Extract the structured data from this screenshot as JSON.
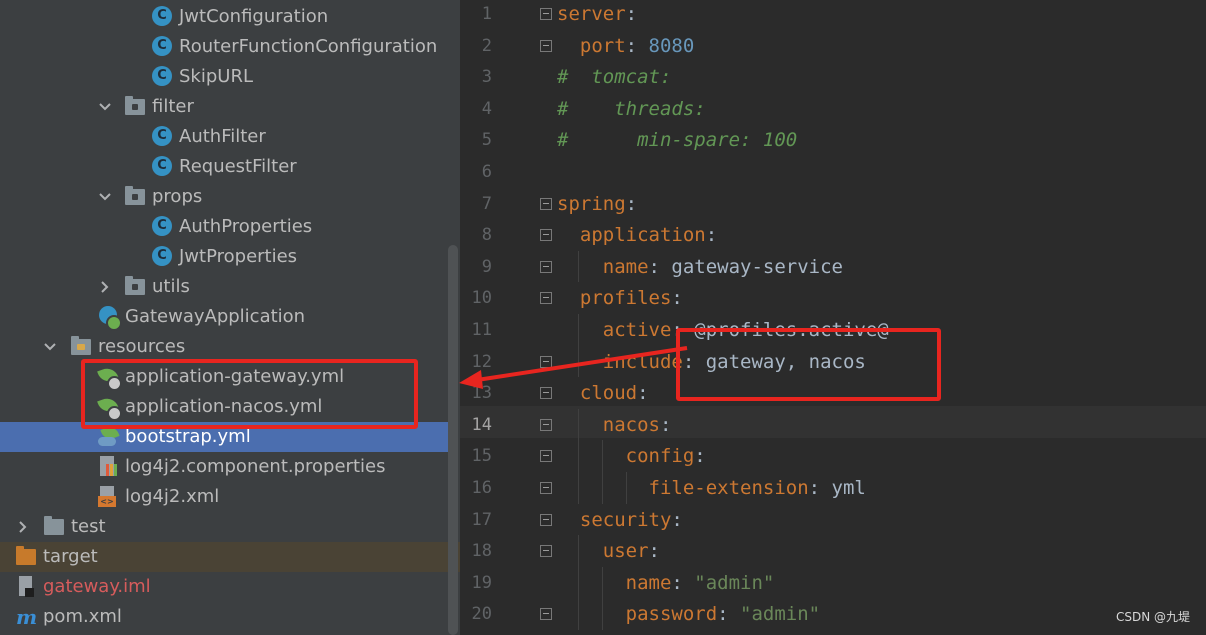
{
  "tree": {
    "items": [
      {
        "label": "JwtConfiguration",
        "icon": "class-icon"
      },
      {
        "label": "RouterFunctionConfiguration",
        "icon": "class-icon"
      },
      {
        "label": "SkipURL",
        "icon": "class-icon"
      },
      {
        "label": "filter",
        "icon": "package-folder-icon",
        "expanded": true
      },
      {
        "label": "AuthFilter",
        "icon": "class-icon"
      },
      {
        "label": "RequestFilter",
        "icon": "class-icon"
      },
      {
        "label": "props",
        "icon": "package-folder-icon",
        "expanded": true
      },
      {
        "label": "AuthProperties",
        "icon": "class-icon"
      },
      {
        "label": "JwtProperties",
        "icon": "class-icon"
      },
      {
        "label": "utils",
        "icon": "package-folder-icon",
        "expanded": false
      },
      {
        "label": "GatewayApplication",
        "icon": "spring-boot-app-icon"
      },
      {
        "label": "resources",
        "icon": "resources-folder-icon",
        "expanded": true
      },
      {
        "label": "application-gateway.yml",
        "icon": "spring-config-icon"
      },
      {
        "label": "application-nacos.yml",
        "icon": "spring-config-icon"
      },
      {
        "label": "bootstrap.yml",
        "icon": "spring-cloud-config-icon",
        "selected": true
      },
      {
        "label": "log4j2.component.properties",
        "icon": "properties-file-icon"
      },
      {
        "label": "log4j2.xml",
        "icon": "xml-file-icon"
      },
      {
        "label": "test",
        "icon": "folder-icon",
        "expanded": false
      },
      {
        "label": "target",
        "icon": "excluded-folder-icon"
      },
      {
        "label": "gateway.iml",
        "icon": "iml-file-icon"
      },
      {
        "label": "pom.xml",
        "icon": "maven-icon"
      }
    ]
  },
  "editor": {
    "current_line": 14,
    "lines": [
      {
        "num": "1",
        "parts": [
          [
            "k",
            "server"
          ],
          [
            "p",
            ":"
          ]
        ]
      },
      {
        "num": "2",
        "parts": [
          [
            "p",
            "  "
          ],
          [
            "k",
            "port"
          ],
          [
            "p",
            ": "
          ],
          [
            "n",
            "8080"
          ]
        ]
      },
      {
        "num": "3",
        "parts": [
          [
            "c",
            "#  tomcat:"
          ]
        ]
      },
      {
        "num": "4",
        "parts": [
          [
            "c",
            "#    threads:"
          ]
        ]
      },
      {
        "num": "5",
        "parts": [
          [
            "c",
            "#      min-spare: 100"
          ]
        ]
      },
      {
        "num": "6",
        "parts": []
      },
      {
        "num": "7",
        "parts": [
          [
            "k",
            "spring"
          ],
          [
            "p",
            ":"
          ]
        ]
      },
      {
        "num": "8",
        "parts": [
          [
            "p",
            "  "
          ],
          [
            "k",
            "application"
          ],
          [
            "p",
            ":"
          ]
        ]
      },
      {
        "num": "9",
        "parts": [
          [
            "p",
            "    "
          ],
          [
            "k",
            "name"
          ],
          [
            "p",
            ": gateway-service"
          ]
        ]
      },
      {
        "num": "10",
        "parts": [
          [
            "p",
            "  "
          ],
          [
            "k",
            "profiles"
          ],
          [
            "p",
            ":"
          ]
        ]
      },
      {
        "num": "11",
        "parts": [
          [
            "p",
            "    "
          ],
          [
            "k",
            "active"
          ],
          [
            "p",
            ": @profiles.active@"
          ]
        ]
      },
      {
        "num": "12",
        "parts": [
          [
            "p",
            "    "
          ],
          [
            "k",
            "include"
          ],
          [
            "p",
            ": gateway, nacos"
          ]
        ]
      },
      {
        "num": "13",
        "parts": [
          [
            "p",
            "  "
          ],
          [
            "k",
            "cloud"
          ],
          [
            "p",
            ":"
          ]
        ]
      },
      {
        "num": "14",
        "parts": [
          [
            "p",
            "    "
          ],
          [
            "k",
            "nacos"
          ],
          [
            "p",
            ":"
          ]
        ]
      },
      {
        "num": "15",
        "parts": [
          [
            "p",
            "      "
          ],
          [
            "k",
            "config"
          ],
          [
            "p",
            ":"
          ]
        ]
      },
      {
        "num": "16",
        "parts": [
          [
            "p",
            "        "
          ],
          [
            "k",
            "file-extension"
          ],
          [
            "p",
            ": yml"
          ]
        ]
      },
      {
        "num": "17",
        "parts": [
          [
            "p",
            "  "
          ],
          [
            "k",
            "security"
          ],
          [
            "p",
            ":"
          ]
        ]
      },
      {
        "num": "18",
        "parts": [
          [
            "p",
            "    "
          ],
          [
            "k",
            "user"
          ],
          [
            "p",
            ":"
          ]
        ]
      },
      {
        "num": "19",
        "parts": [
          [
            "p",
            "      "
          ],
          [
            "k",
            "name"
          ],
          [
            "p",
            ": "
          ],
          [
            "s",
            "\"admin\""
          ]
        ]
      },
      {
        "num": "20",
        "parts": [
          [
            "p",
            "      "
          ],
          [
            "k",
            "password"
          ],
          [
            "p",
            ": "
          ],
          [
            "s",
            "\"admin\""
          ]
        ]
      }
    ]
  },
  "watermark": "CSDN @九堤",
  "colors": {
    "highlight_box": "#e8251f",
    "selection": "#4b6eaf",
    "keyword": "#cc7832",
    "number": "#6897bb",
    "string": "#6a8759",
    "comment": "#629755"
  }
}
